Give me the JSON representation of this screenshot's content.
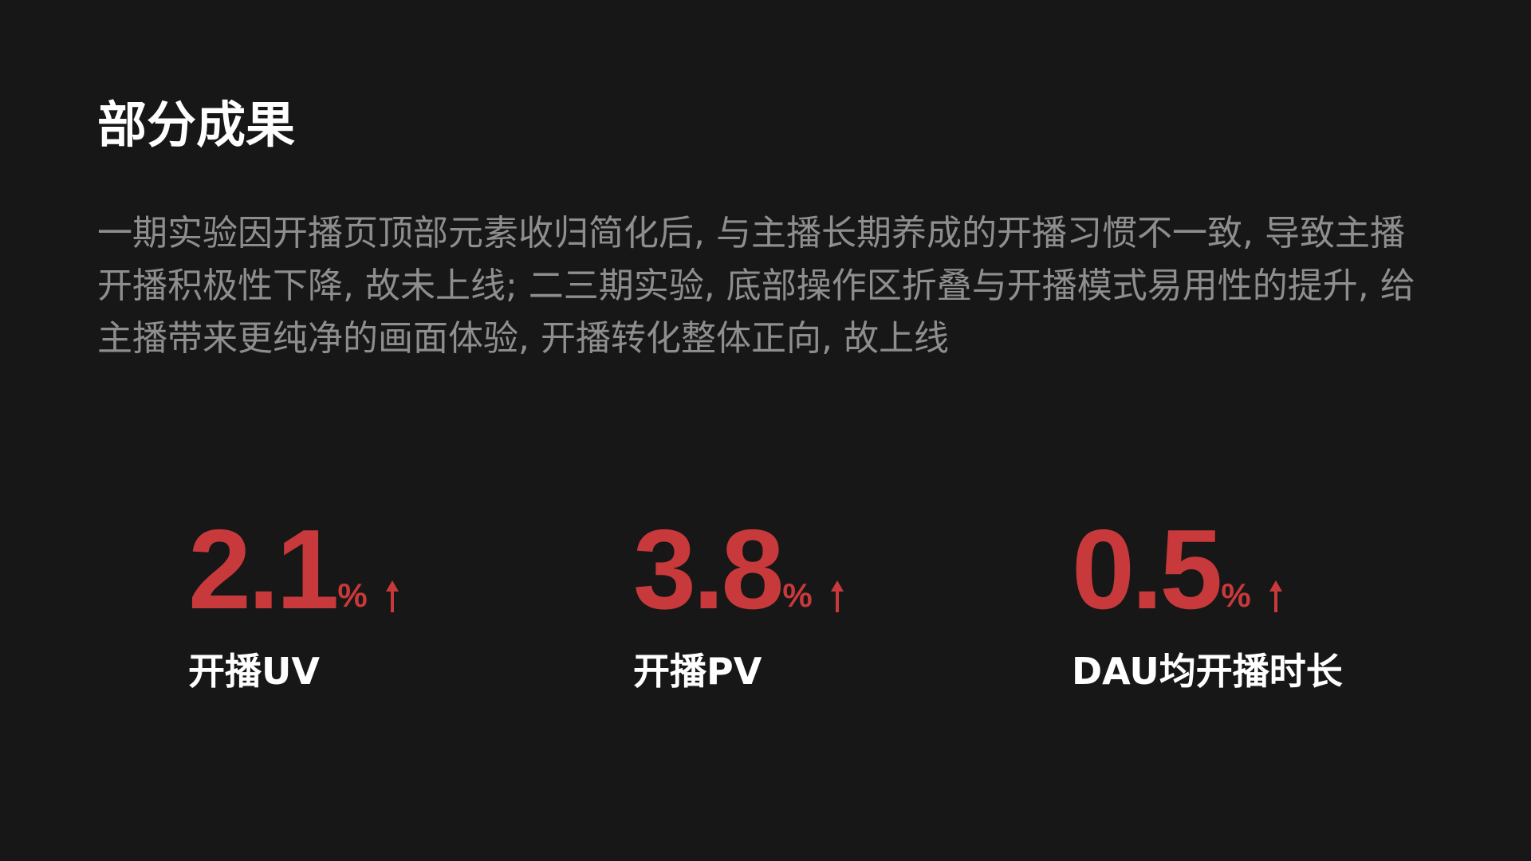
{
  "heading": "部分成果",
  "description": "一期实验因开播页顶部元素收归简化后, 与主播长期养成的开播习惯不一致, 导致主播开播积极性下降, 故未上线; 二三期实验, 底部操作区折叠与开播模式易用性的提升, 给主播带来更纯净的画面体验, 开播转化整体正向, 故上线",
  "metrics": [
    {
      "value": "2.1",
      "unit": "%",
      "trend_icon": "arrow-up-icon",
      "label": "开播UV"
    },
    {
      "value": "3.8",
      "unit": "%",
      "trend_icon": "arrow-up-icon",
      "label": "开播PV"
    },
    {
      "value": "0.5",
      "unit": "%",
      "trend_icon": "arrow-up-icon",
      "label": "DAU均开播时长"
    }
  ],
  "colors": {
    "background": "#171717",
    "accent": "#c8393b",
    "heading": "#ffffff",
    "body_text": "#8e8e8e"
  }
}
